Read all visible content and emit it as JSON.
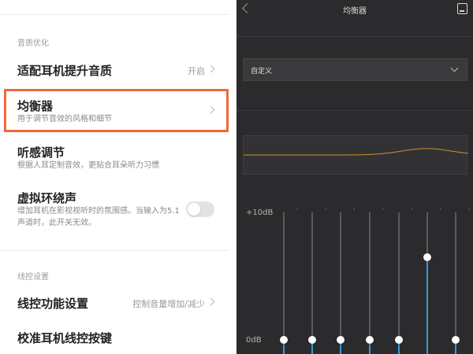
{
  "left_panel": {
    "section_audio": "音质优化",
    "adaptive": {
      "title": "适配耳机提升音质",
      "value": "开启"
    },
    "equalizer": {
      "title": "均衡器",
      "subtitle": "用于调节音效的风格和细节"
    },
    "hearing": {
      "title": "听感调节",
      "subtitle": "根据人耳定制音效，更贴合耳朵听力习惯"
    },
    "surround": {
      "title": "虚拟环绕声",
      "subtitle": "增加耳机在影视视听时的氛围感。当输入为5.1声道时，此开关无效。",
      "enabled": false
    },
    "section_wire": "线控设置",
    "wire_function": {
      "title": "线控功能设置",
      "value": "控制音量增加/减少"
    },
    "calibrate": {
      "title": "校准耳机线控按键"
    }
  },
  "equalizer_panel": {
    "title": "均衡器",
    "preset": "自定义",
    "db_max_label": "+10dB",
    "db_zero_label": "0dB",
    "accent_color": "#2f9be0",
    "curve_color": "#c8942a",
    "bands": [
      0,
      0,
      0,
      0,
      0,
      6.5,
      0
    ]
  },
  "icons": {
    "back": "chevron-left-icon",
    "save": "save-icon",
    "dropdown": "chevron-down-icon",
    "row_chevron": "chevron-right-icon"
  }
}
